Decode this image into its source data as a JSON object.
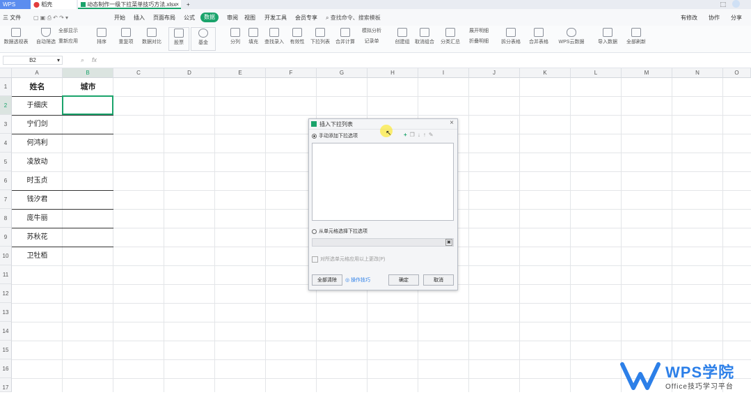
{
  "titlebar": {
    "tabs": [
      {
        "label": "WPS",
        "color": "#5b8def"
      },
      {
        "label": "稻壳",
        "color": "#ffffff"
      },
      {
        "label": "动态制作一级下拉菜单技巧方法.xlsx",
        "color": "#ffffff"
      }
    ],
    "new_tab": "+"
  },
  "menubar": {
    "file": "三 文件",
    "items": [
      "开始",
      "插入",
      "页面布局",
      "公式",
      "数据",
      "审阅",
      "视图",
      "开发工具",
      "会员专享"
    ],
    "active": "数据",
    "search": "查找命令、搜索模板",
    "right": [
      "有修改",
      "协作",
      "分享"
    ]
  },
  "toolbar": {
    "items": [
      "数据透视表",
      "自动筛选",
      "全部显示",
      "重新应用",
      "排序",
      "重复项",
      "数据对比",
      "股票",
      "基金",
      "分列",
      "填充",
      "查找录入",
      "有效性",
      "下拉列表",
      "合并计算",
      "记录单",
      "创建组",
      "取消组合",
      "分类汇总",
      "展开明细",
      "折叠明细",
      "拆分表格",
      "合并表格",
      "WPS云数据",
      "导入数据",
      "全部刷新"
    ]
  },
  "formula_bar": {
    "name_box": "B2",
    "fx": "fx"
  },
  "grid": {
    "columns": [
      "A",
      "B",
      "C",
      "D",
      "E",
      "F",
      "G",
      "H",
      "I",
      "J",
      "K",
      "L",
      "M",
      "N",
      "O"
    ],
    "rows": [
      "1",
      "2",
      "3",
      "4",
      "5",
      "6",
      "7",
      "8",
      "9",
      "10",
      "11",
      "12",
      "13",
      "14",
      "15",
      "16",
      "17"
    ],
    "header_name": "姓名",
    "header_city": "城市",
    "names": [
      "于细庆",
      "宁们剑",
      "何鸿利",
      "凌放动",
      "时玉贞",
      "钱汐君",
      "庞牛丽",
      "苏秋花",
      "卫牡栢"
    ]
  },
  "dialog": {
    "title": "插入下拉列表",
    "option_manual": "手动添加下拉选项",
    "option_range": "从单元格选择下拉选项",
    "checkbox_label": "对所选单元格应用以上更改(P)",
    "clear_button": "全部清除",
    "tips_link": "操作技巧",
    "ok_button": "确定",
    "cancel_button": "取消"
  },
  "watermark": {
    "logo_text": "WPS学院",
    "tagline": "Office技巧学习平台"
  },
  "colors": {
    "accent": "#1aa36b",
    "brand_blue": "#2c7fe8"
  }
}
